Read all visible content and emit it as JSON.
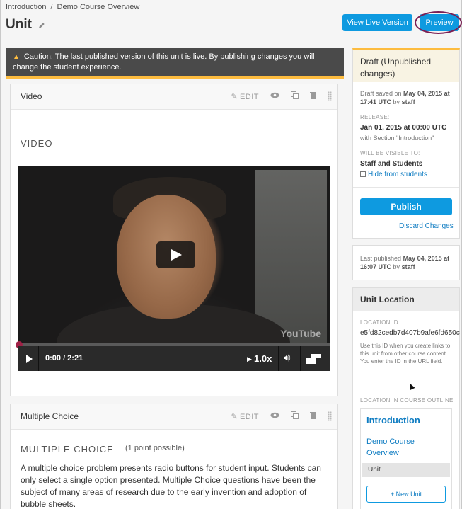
{
  "breadcrumb": {
    "parent": "Introduction",
    "separator": "/",
    "current": "Demo Course Overview"
  },
  "page_title": "Unit",
  "header_buttons": {
    "view_live": "View Live Version",
    "preview": "Preview"
  },
  "caution": {
    "text": "Caution: The last published version of this unit is live. By publishing changes you will change the student experience."
  },
  "video_component": {
    "name": "Video",
    "edit_label": "EDIT",
    "heading": "VIDEO",
    "youtube_label": "YouTube",
    "time": "0:00 / 2:21",
    "speed": "1.0x",
    "progress": 0.0
  },
  "mc_component": {
    "name": "Multiple Choice",
    "edit_label": "EDIT",
    "heading": "MULTIPLE CHOICE",
    "points": "(1 point possible)",
    "text": "A multiple choice problem presents radio buttons for student input. Students can only select a single option presented. Multiple Choice questions have been the subject of many areas of research due to the early invention and adoption of bubble sheets."
  },
  "draft": {
    "title": "Draft (Unpublished changes)",
    "saved_prefix": "Draft saved on",
    "saved_date": "May 04, 2015 at 17:41 UTC",
    "saved_by_prefix": "by",
    "saved_by": "staff",
    "release_label": "RELEASE:",
    "release_value": "Jan 01, 2015 at 00:00 UTC",
    "release_section": "with Section \"Introduction\"",
    "visible_label": "WILL BE VISIBLE TO:",
    "visible_value": "Staff and Students",
    "hide_label": "Hide from students",
    "publish_label": "Publish",
    "discard_label": "Discard Changes"
  },
  "published": {
    "prefix": "Last published",
    "date": "May 04, 2015 at 16:07 UTC",
    "by_prefix": "by",
    "by": "staff"
  },
  "location": {
    "title": "Unit Location",
    "id_label": "LOCATION ID",
    "id_value": "e5fd82cedb7d407b9afe6fd650c",
    "help": "Use this ID when you create links to this unit from other course content. You enter the ID in the URL field.",
    "outline_label": "LOCATION IN COURSE OUTLINE",
    "section": "Introduction",
    "subsection": "Demo Course Overview",
    "unit": "Unit",
    "new_unit_label": "New Unit"
  },
  "colors": {
    "accent": "#0e9ae0",
    "warning": "#fdbc3f",
    "highlight_ring": "#7a1f54"
  }
}
